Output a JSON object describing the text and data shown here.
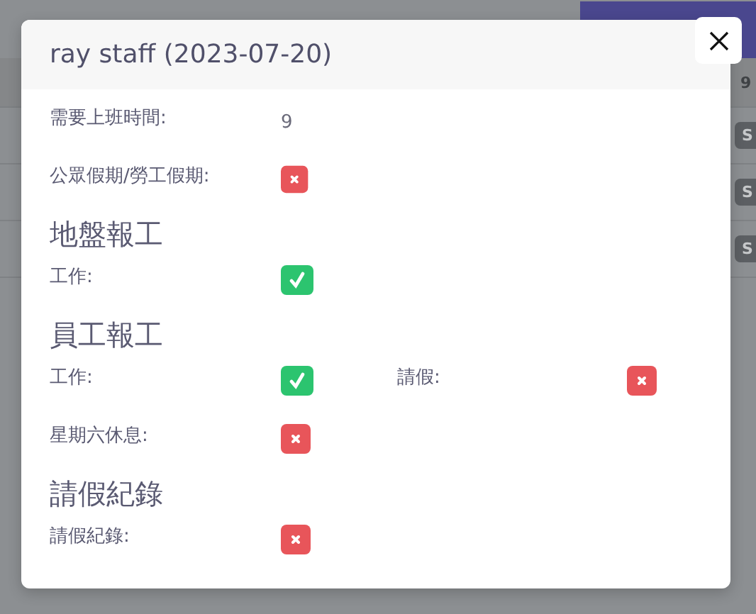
{
  "background": {
    "column_header": "9",
    "badges": [
      "S",
      "S",
      "S"
    ]
  },
  "modal": {
    "title": "ray staff (2023-07-20)",
    "fields": [
      [
        {
          "label": "需要上班時間:",
          "kind": "text",
          "value": "9"
        }
      ],
      [
        {
          "label": "公眾假期/勞工假期:",
          "kind": "flag",
          "checked": false
        }
      ]
    ],
    "sections": [
      {
        "heading": "地盤報工",
        "rows": [
          [
            {
              "label": "工作:",
              "kind": "flag",
              "checked": true
            }
          ]
        ]
      },
      {
        "heading": "員工報工",
        "rows": [
          [
            {
              "label": "工作:",
              "kind": "flag",
              "checked": true
            },
            {
              "label": "請假:",
              "kind": "flag",
              "checked": false
            }
          ],
          [
            {
              "label": "星期六休息:",
              "kind": "flag",
              "checked": false
            }
          ]
        ]
      },
      {
        "heading": "請假紀錄",
        "rows": [
          [
            {
              "label": "請假紀錄:",
              "kind": "flag",
              "checked": false
            }
          ]
        ]
      }
    ]
  }
}
